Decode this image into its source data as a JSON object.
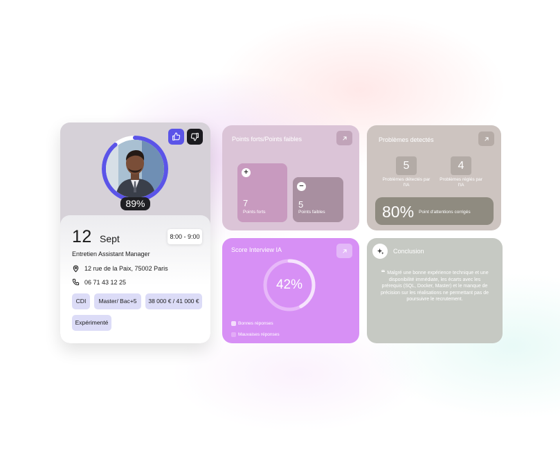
{
  "profile": {
    "score": "89%",
    "score_fraction": 0.89,
    "actions": {
      "like_icon": "thumb-up-icon",
      "dislike_icon": "thumb-down-icon"
    },
    "date_day": "12",
    "date_month": "Sept",
    "time": "8:00 - 9:00",
    "title": "Entretien Assistant Manager",
    "address": "12 rue de la Paix, 75002 Paris",
    "phone": "06 71 43 12 25",
    "tags": [
      "CDI",
      "Master/ Bac+5",
      "38 000 € / 41 000 €",
      "Expérimenté"
    ]
  },
  "strengths": {
    "title": "Points forts/Points faibles",
    "strong_count": "7",
    "strong_label": "Points forts",
    "weak_count": "5",
    "weak_label": "Points faibles"
  },
  "problems": {
    "title": "Problèmes detectés",
    "detected_count": "5",
    "detected_label": "Problèmes détectés par l'IA",
    "fixed_count": "4",
    "fixed_label": "Problèmes réglés par l'IA",
    "attention_pct": "80%",
    "attention_label": "Point d'attentions corrigés"
  },
  "score": {
    "title": "Score Interview IA",
    "value": "42%",
    "fraction": 0.42,
    "legend_good": "Bonnes réponses",
    "legend_bad": "Mauvaises réponses"
  },
  "conclusion": {
    "title": "Conclusion",
    "quote_mark": "❝",
    "text": "Malgré une bonne expérience technique et une disponibilité immédiate, les écarts avec les prérequis (SQL, Docker, Master) et le manque de précision sur les réalisations ne permettant pas de poursuivre le recrutement."
  },
  "colors": {
    "accent_indigo": "#5b54e8",
    "score_purple": "#d790f5",
    "strong_tile": "#c89abf",
    "weak_tile": "#a88fa0"
  }
}
